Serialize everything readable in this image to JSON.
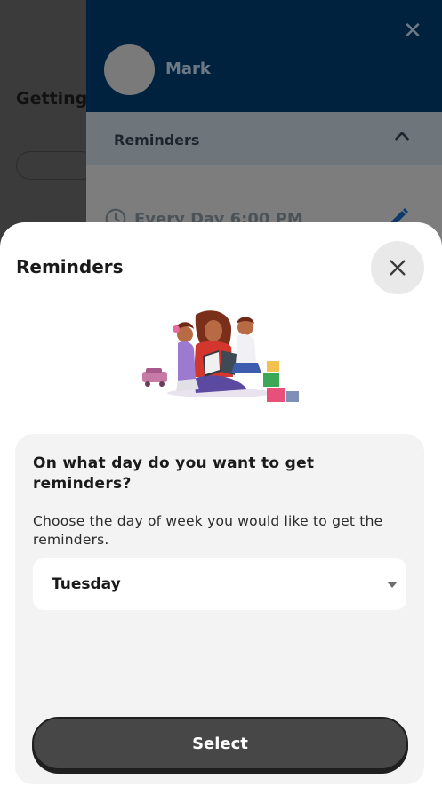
{
  "background": {
    "title": "Getting"
  },
  "drawer": {
    "user_name": "Mark",
    "close_glyph": "✕",
    "section_label": "Reminders",
    "reminder_text": "Every Day 6:00 PM"
  },
  "sheet": {
    "title": "Reminders",
    "question": "On what day do you want to get reminders?",
    "description": "Choose the day of week you would like to get the reminders.",
    "selected_day": "Tuesday",
    "select_button_label": "Select"
  },
  "colors": {
    "drawer_header": "#00223f",
    "button": "#474747",
    "card": "#f3f3f3"
  },
  "icons": {
    "sheet_close": "close-icon",
    "drawer_close": "close-icon",
    "section_toggle": "chevron-up-icon",
    "reminder": "clock-icon",
    "edit": "pencil-icon",
    "dropdown": "caret-down-icon"
  }
}
